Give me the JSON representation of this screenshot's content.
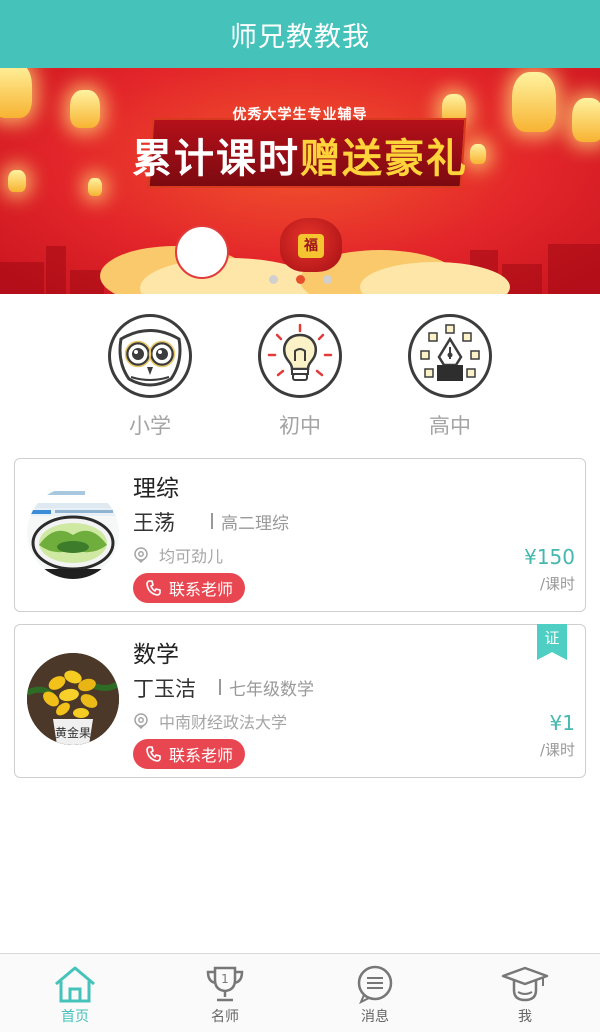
{
  "app": {
    "title": "师兄教教我"
  },
  "banner": {
    "subtitle": "优秀大学生专业辅导",
    "headline_white": "累计课时",
    "headline_yellow": "赠送豪礼",
    "bag_glyph": "福",
    "active_slide": 2,
    "slide_count": 3
  },
  "categories": [
    {
      "label": "小学",
      "icon": "owl-icon"
    },
    {
      "label": "初中",
      "icon": "lightbulb-icon"
    },
    {
      "label": "高中",
      "icon": "pen-nib-icon"
    }
  ],
  "teachers": [
    {
      "subject": "理综",
      "name": "王荡",
      "desc": "高二理综",
      "location": "均可劲儿",
      "contact_label": "联系老师",
      "price": "¥150",
      "unit": "/课时",
      "certified": false
    },
    {
      "subject": "数学",
      "name": "丁玉洁",
      "desc": "七年级数学",
      "location": "中南财经政法大学",
      "contact_label": "联系老师",
      "price": "¥1",
      "unit": "/课时",
      "certified": true,
      "cert_label": "证"
    }
  ],
  "tabbar": [
    {
      "label": "首页",
      "icon": "home-icon",
      "active": true
    },
    {
      "label": "名师",
      "icon": "trophy-icon",
      "active": false
    },
    {
      "label": "消息",
      "icon": "message-icon",
      "active": false
    },
    {
      "label": "我",
      "icon": "graduate-icon",
      "active": false
    }
  ],
  "colors": {
    "accent": "#45c3bb",
    "contact": "#e84751",
    "price": "#45b8b0"
  }
}
